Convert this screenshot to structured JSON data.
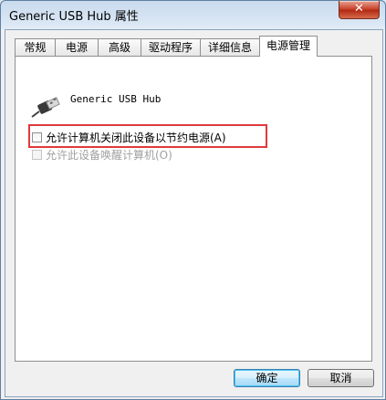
{
  "window": {
    "title": "Generic USB Hub 属性",
    "close_label": "✕"
  },
  "tabs": [
    {
      "label": "常规"
    },
    {
      "label": "电源"
    },
    {
      "label": "高级"
    },
    {
      "label": "驱动程序"
    },
    {
      "label": "详细信息"
    },
    {
      "label": "电源管理",
      "active": true
    }
  ],
  "device": {
    "name": "Generic USB Hub",
    "icon": "usb-connector-icon"
  },
  "options": {
    "allow_turn_off": {
      "label": "允许计算机关闭此设备以节约电源(A)",
      "checked": false,
      "enabled": true
    },
    "allow_wake": {
      "label": "允许此设备唤醒计算机(O)",
      "checked": false,
      "enabled": false
    }
  },
  "buttons": {
    "ok": "确定",
    "cancel": "取消"
  },
  "colors": {
    "highlight": "#e03a3c"
  }
}
